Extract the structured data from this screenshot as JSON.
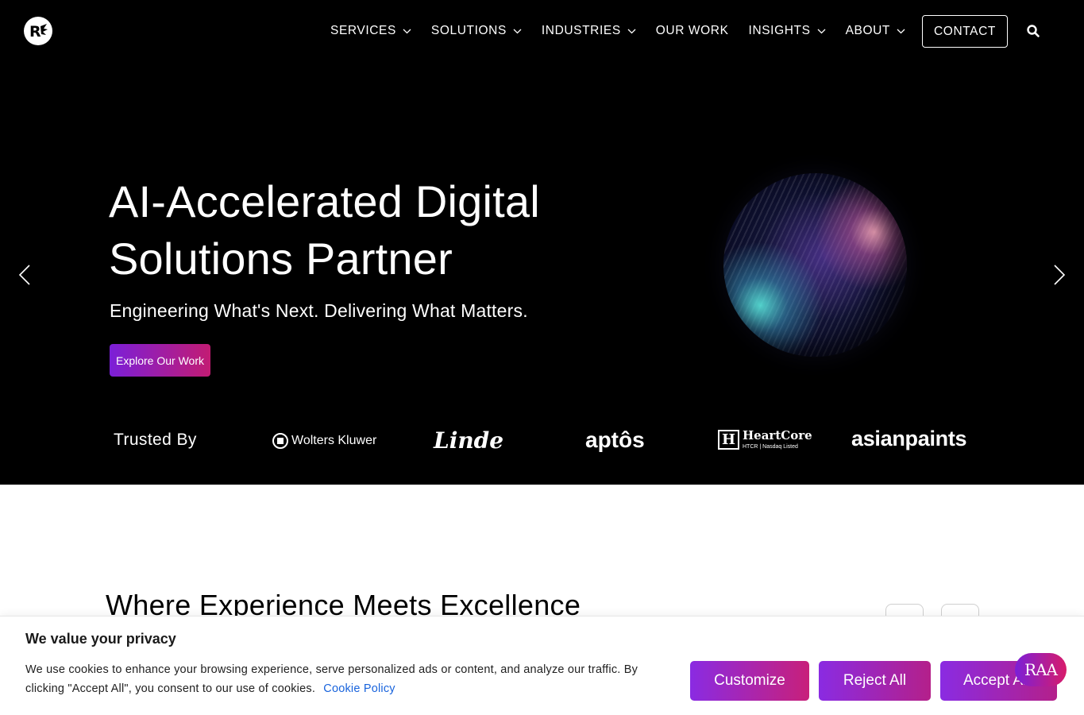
{
  "nav": {
    "items": [
      {
        "label": "SERVICES",
        "has_dropdown": true
      },
      {
        "label": "SOLUTIONS",
        "has_dropdown": true
      },
      {
        "label": "INDUSTRIES",
        "has_dropdown": true
      },
      {
        "label": "OUR WORK",
        "has_dropdown": false
      },
      {
        "label": "INSIGHTS",
        "has_dropdown": true
      },
      {
        "label": "ABOUT",
        "has_dropdown": true
      }
    ],
    "contact_label": "CONTACT"
  },
  "hero": {
    "title_line1": "AI-Accelerated Digital",
    "title_line2": "Solutions Partner",
    "subtitle": "Engineering What's Next. Delivering What Matters.",
    "cta_label": "Explore Our Work",
    "trusted_label": "Trusted By",
    "clients": {
      "wolters": "Wolters Kluwer",
      "linde": "Linde",
      "aptos": "aptôs",
      "heartcore": "HeartCore",
      "heartcore_sub": "HTCR | Nasdaq Listed",
      "asianpaints": "asianpaints"
    }
  },
  "section2": {
    "title": "Where Experience Meets Excellence"
  },
  "cookie": {
    "title": "We value your privacy",
    "text": "We use cookies to enhance your browsing experience, serve personalized ads or content, and analyze our traffic. By clicking \"Accept All\", you consent to our use of cookies.",
    "link": "Cookie Policy",
    "customize": "Customize",
    "reject": "Reject All",
    "accept": "Accept All"
  },
  "chat_badge": "RAA",
  "colors": {
    "accent_start": "#7b1fd8",
    "accent_end": "#c21c73",
    "link": "#1863dc"
  }
}
